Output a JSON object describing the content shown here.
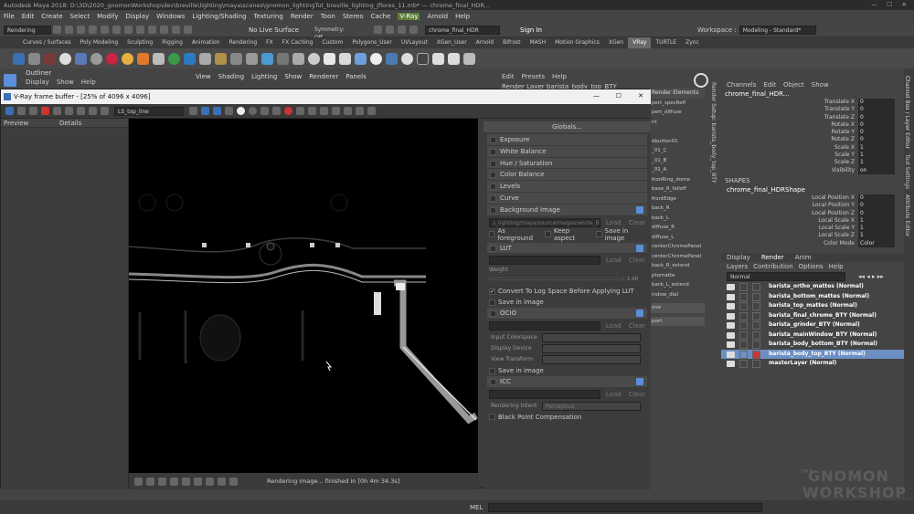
{
  "window": {
    "title": "Autodesk Maya 2018: D:\\3D\\2020_gnomonWorkshop\\dev\\breville\\lighting\\maya\\scenes\\gnomon_lightingTut_breville_lighting_jflores_11.mb* --- chrome_final_HDR..."
  },
  "menubar": [
    "File",
    "Edit",
    "Create",
    "Select",
    "Modify",
    "Display",
    "Windows",
    "Lighting/Shading",
    "Texturing",
    "Render",
    "Toon",
    "Stereo",
    "Cache",
    "V-Ray",
    "Arnold",
    "Help"
  ],
  "statusline": {
    "mode": "Rendering",
    "live_surface": "No Live Surface",
    "symmetry": "Symmetry: Off",
    "search": "chrome_final_HDR",
    "signin": "Sign In",
    "workspace_label": "Workspace :",
    "workspace": "Modeling - Standard*"
  },
  "shelf_tabs": [
    "Curves / Surfaces",
    "Poly Modeling",
    "Sculpting",
    "Rigging",
    "Animation",
    "Rendering",
    "FX",
    "FX Caching",
    "Custom",
    "Polygons_User",
    "UVLayout",
    "XGen_User",
    "Arnold",
    "Bifrost",
    "MASH",
    "Motion Graphics",
    "XGen",
    "VRay",
    "TURTLE",
    "Zync"
  ],
  "outliner": {
    "title": "Outliner",
    "menu": [
      "Display",
      "Show",
      "Help"
    ]
  },
  "viewport_menu": [
    "View",
    "Shading",
    "Lighting",
    "Show",
    "Renderer",
    "Panels"
  ],
  "vfb": {
    "title": "V-Ray frame buffer - [25% of 4096 x 4096]",
    "channel": "LS_top_line",
    "history_cols": [
      "Preview",
      "Details"
    ],
    "status": "Rendering image... finished in [0h 4m 34.3s]",
    "globals": "Globals...",
    "cc": {
      "exposure": "Exposure",
      "white_balance": "White Balance",
      "hue_sat": "Hue / Saturation",
      "color_balance": "Color Balance",
      "levels": "Levels",
      "curve": "Curve",
      "bg_image": "Background Image",
      "bg_path": "s_lighting/maya/sourceimages/white_BG.jpg",
      "load": "Load",
      "clear": "Clear",
      "as_fg": "As foreground",
      "keep_aspect": "Keep aspect",
      "save_in_image": "Save in image",
      "lut": "LUT",
      "weight": "Weight",
      "weight_val": "1.00",
      "convert_log": "Convert To Log Space Before Applying LUT",
      "ocio": "OCIO",
      "input_cs": "Input Colorspace",
      "display_dev": "Display Device",
      "view_transform": "View Transform",
      "icc": "ICC",
      "rendering_intent": "Rendering Intent",
      "perceptual": "Perceptual",
      "bpc": "Black Point Compensation"
    }
  },
  "render_setup": {
    "menu": [
      "Edit",
      "Presets",
      "Help"
    ],
    "layer": "Render Layer  barista_body_top_BTY",
    "tab": "Render Elements",
    "items": [
      "pert_specRefl",
      "pert_diffuse",
      "nt",
      "",
      "dbutton01",
      "_01_C",
      "_01_B",
      "_01_A",
      "ttonRing_dome",
      "base_R_falloff",
      "frontEdge",
      "back_R",
      "back_L",
      "diffuse_R",
      "diffuse_L",
      "centerChromePanel",
      "centerChromePanel",
      "back_R_extend",
      "ptomatte",
      "back_L_extend",
      "indow_dial"
    ],
    "btns": [
      "ove",
      "port"
    ]
  },
  "channel_box": {
    "menu": [
      "Channels",
      "Edit",
      "Object",
      "Show"
    ],
    "object": "chrome_final_HDR...",
    "attrs": [
      [
        "Translate X",
        "0"
      ],
      [
        "Translate Y",
        "0"
      ],
      [
        "Translate Z",
        "0"
      ],
      [
        "Rotate X",
        "0"
      ],
      [
        "Rotate Y",
        "0"
      ],
      [
        "Rotate Z",
        "0"
      ],
      [
        "Scale X",
        "1"
      ],
      [
        "Scale Y",
        "1"
      ],
      [
        "Scale Z",
        "1"
      ],
      [
        "Visibility",
        "on"
      ]
    ],
    "shapes_label": "SHAPES",
    "shape": "chrome_final_HDRShape",
    "shape_attrs": [
      [
        "Local Position X",
        "0"
      ],
      [
        "Local Position Y",
        "0"
      ],
      [
        "Local Position Z",
        "0"
      ],
      [
        "Local Scale X",
        "1"
      ],
      [
        "Local Scale Y",
        "1"
      ],
      [
        "Local Scale Z",
        "1"
      ],
      [
        "Color Mode",
        "Color"
      ]
    ]
  },
  "layer_editor": {
    "tabs": [
      "Display",
      "Render",
      "Anim"
    ],
    "menu": [
      "Layers",
      "Contribution",
      "Options",
      "Help"
    ],
    "mode": "Normal",
    "layers": [
      "barista_ortho_mattes (Normal)",
      "barista_bottom_mattes (Normal)",
      "barista_top_mattes (Normal)",
      "barista_final_chrome_BTY (Normal)",
      "barista_grinder_BTY (Normal)",
      "barista_mainWindow_BTY (Normal)",
      "barista_body_bottom_BTY (Normal)",
      "barista_body_top_BTY (Normal)",
      "masterLayer (Normal)"
    ]
  },
  "side_tabs": [
    "Channel Box / Layer Editor",
    "Tool Settings",
    "Attribute Editor"
  ],
  "vertical_label": "Render Setup: barista_body_top_BTY",
  "helpline": "MEL",
  "watermark": [
    "THE",
    "GNOMON",
    "WORKSHOP"
  ],
  "colors": {
    "accent": "#5b8fd9",
    "selected_layer": "#6d90c4",
    "vray_tab": "#6a6a6a"
  }
}
